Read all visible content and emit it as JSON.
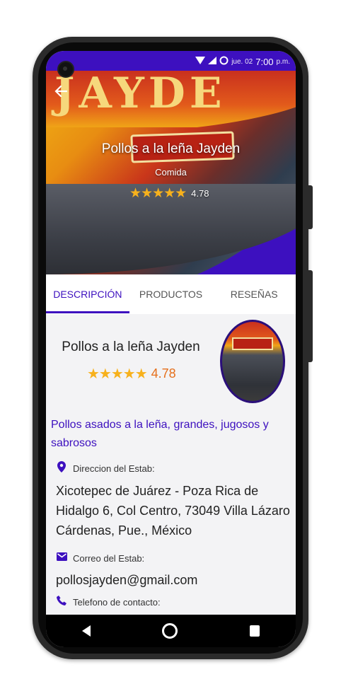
{
  "status_bar": {
    "date": "jue. 02",
    "time": "7:00",
    "period": "p.m."
  },
  "hero": {
    "sign_text": "JAYDE",
    "title": "Pollos a la leña Jayden",
    "category": "Comida",
    "rating": "4.78"
  },
  "tabs": [
    {
      "label": "DESCRIPCIÓN"
    },
    {
      "label": "PRODUCTOS"
    },
    {
      "label": "RESEÑAS"
    }
  ],
  "business": {
    "name": "Pollos a la leña Jayden",
    "rating": "4.78",
    "description": "Pollos asados a la leña, grandes, jugosos y sabrosos"
  },
  "fields": {
    "address_label": "Direccion del Estab:",
    "address_value": "Xicotepec de Juárez - Poza Rica de Hidalgo 6, Col Centro, 73049 Villa Lázaro Cárdenas, Pue., México",
    "email_label": "Correo del Estab:",
    "email_value": "pollosjayden@gmail.com",
    "phone_label": "Telefono de contacto:"
  },
  "colors": {
    "primary": "#3d10bf",
    "star": "#f7b11c",
    "rating_text": "#e56f1b"
  }
}
